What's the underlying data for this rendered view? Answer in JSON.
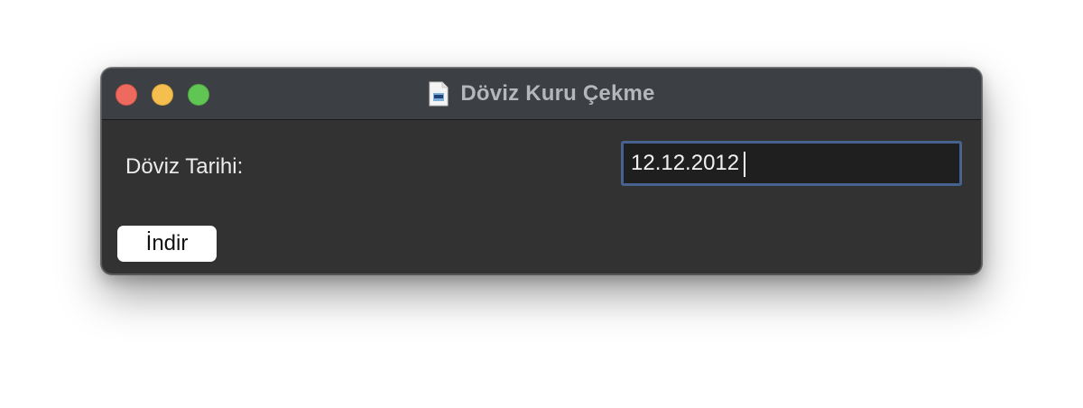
{
  "window": {
    "title": "Döviz Kuru Çekme",
    "title_icon": "document-icon"
  },
  "form": {
    "date_label": "Döviz Tarihi:",
    "date_value": "12.12.2012",
    "download_button_label": "İndir"
  },
  "colors": {
    "window_background": "#323232",
    "titlebar_background": "#3c3f43",
    "input_background": "#1f1f1f",
    "input_focus_border": "#48628f",
    "close": "#ee6a5f",
    "minimize": "#f5bf4f",
    "zoom": "#61c554"
  }
}
